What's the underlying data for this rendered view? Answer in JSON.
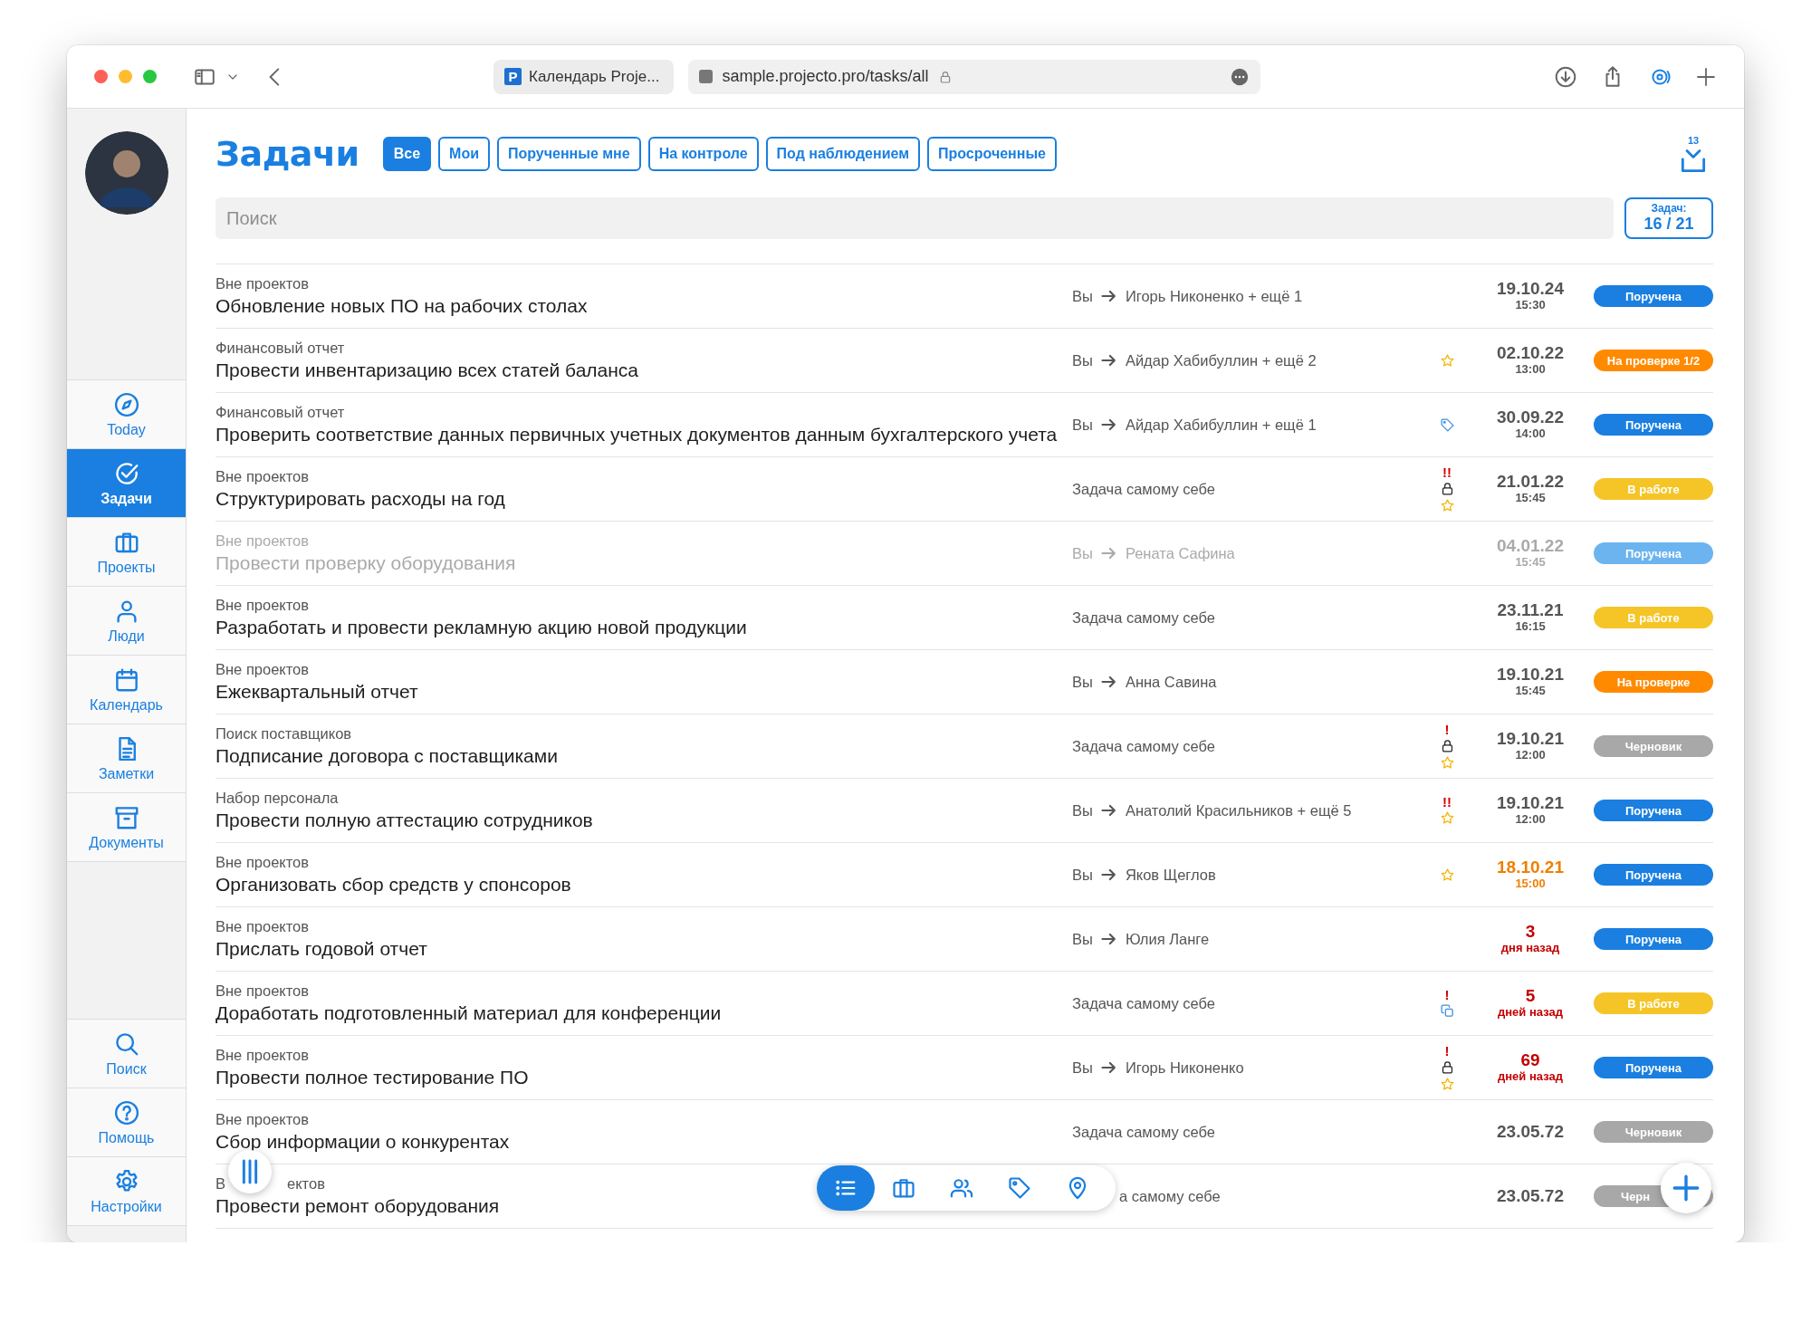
{
  "browser": {
    "favicon_text": "P",
    "tab_title": "Календарь Proje...",
    "url": "sample.projecto.pro/tasks/all"
  },
  "sidebar": {
    "items": [
      {
        "label": "Today",
        "kind": "compass",
        "selected": false
      },
      {
        "label": "Задачи",
        "kind": "check",
        "selected": true
      },
      {
        "label": "Проекты",
        "kind": "briefcase",
        "selected": false
      },
      {
        "label": "Люди",
        "kind": "person",
        "selected": false
      },
      {
        "label": "Календарь",
        "kind": "calendar",
        "selected": false
      },
      {
        "label": "Заметки",
        "kind": "note",
        "selected": false
      },
      {
        "label": "Документы",
        "kind": "archive",
        "selected": false
      }
    ],
    "bottom_items": [
      {
        "label": "Поиск",
        "kind": "search"
      },
      {
        "label": "Помощь",
        "kind": "help"
      },
      {
        "label": "Настройки",
        "kind": "gear"
      }
    ]
  },
  "header": {
    "title": "Задачи",
    "filters": [
      {
        "label": "Все",
        "selected": true
      },
      {
        "label": "Мои",
        "selected": false
      },
      {
        "label": "Порученные мне",
        "selected": false
      },
      {
        "label": "На контроле",
        "selected": false
      },
      {
        "label": "Под наблюдением",
        "selected": false
      },
      {
        "label": "Просроченные",
        "selected": false
      }
    ],
    "inbox_count": "13"
  },
  "search": {
    "placeholder": "Поиск"
  },
  "counter": {
    "label": "Задач:",
    "value": "16 / 21"
  },
  "tasks": [
    {
      "category": "Вне проектов",
      "title": "Обновление новых ПО на рабочих столах",
      "assignee": {
        "kind": "delegated",
        "from": "Вы",
        "to": "Игорь Никоненко + ещё 1"
      },
      "date": "19.10.24",
      "time": "15:30",
      "overdue": false,
      "due_soon": false,
      "status": {
        "label": "Поручена",
        "color": "#1a7fe0"
      },
      "muted": false
    },
    {
      "category": "Финансовый отчет",
      "title": "Провести инвентаризацию всех статей баланса",
      "assignee": {
        "kind": "delegated",
        "from": "Вы",
        "to": "Айдар Хабибуллин + ещё 2"
      },
      "marks": [
        {
          "kind": "star"
        }
      ],
      "date": "02.10.22",
      "time": "13:00",
      "overdue": false,
      "due_soon": false,
      "status": {
        "label": "На проверке 1/2",
        "color": "#ff8a00"
      },
      "muted": false
    },
    {
      "category": "Финансовый отчет",
      "title": "Проверить соответствие данных первичных учетных документов данным бухгалтерского учета",
      "assignee": {
        "kind": "delegated",
        "from": "Вы",
        "to": "Айдар Хабибуллин + ещё 1"
      },
      "marks": [
        {
          "kind": "tag"
        }
      ],
      "date": "30.09.22",
      "time": "14:00",
      "overdue": false,
      "due_soon": false,
      "status": {
        "label": "Поручена",
        "color": "#1a7fe0"
      },
      "muted": false
    },
    {
      "category": "Вне проектов",
      "title": "Структурировать расходы на год",
      "assignee": {
        "kind": "self",
        "text": "Задача самому себе"
      },
      "marks": [
        {
          "kind": "urgency",
          "text": "!!"
        },
        {
          "kind": "lock"
        },
        {
          "kind": "star"
        }
      ],
      "date": "21.01.22",
      "time": "15:45",
      "overdue": false,
      "due_soon": false,
      "status": {
        "label": "В работе",
        "color": "#f5c527"
      },
      "muted": false
    },
    {
      "category": "Вне проектов",
      "title": "Провести проверку оборудования",
      "assignee": {
        "kind": "delegated",
        "from": "Вы",
        "to": "Рената Сафина"
      },
      "date": "04.01.22",
      "time": "15:45",
      "overdue": false,
      "due_soon": false,
      "status": {
        "label": "Поручена",
        "color": "#6cb4ef"
      },
      "muted": true
    },
    {
      "category": "Вне проектов",
      "title": "Разработать и провести рекламную акцию новой продукции",
      "assignee": {
        "kind": "self",
        "text": "Задача самому себе"
      },
      "date": "23.11.21",
      "time": "16:15",
      "overdue": false,
      "due_soon": false,
      "status": {
        "label": "В работе",
        "color": "#f5c527"
      },
      "muted": false
    },
    {
      "category": "Вне проектов",
      "title": "Ежеквартальный отчет",
      "assignee": {
        "kind": "delegated",
        "from": "Вы",
        "to": "Анна Савина"
      },
      "date": "19.10.21",
      "time": "15:45",
      "overdue": false,
      "due_soon": false,
      "status": {
        "label": "На проверке",
        "color": "#ff8a00"
      },
      "muted": false
    },
    {
      "category": "Поиск поставщиков",
      "title": "Подписание договора с поставщиками",
      "assignee": {
        "kind": "self",
        "text": "Задача самому себе"
      },
      "marks": [
        {
          "kind": "urgency",
          "text": "!"
        },
        {
          "kind": "lock"
        },
        {
          "kind": "star"
        }
      ],
      "date": "19.10.21",
      "time": "12:00",
      "overdue": false,
      "due_soon": false,
      "status": {
        "label": "Черновик",
        "color": "#a8a8a8"
      },
      "muted": false
    },
    {
      "category": "Набор персонала",
      "title": "Провести полную аттестацию сотрудников",
      "assignee": {
        "kind": "delegated",
        "from": "Вы",
        "to": "Анатолий Красильников + ещё 5"
      },
      "marks": [
        {
          "kind": "urgency",
          "text": "!!"
        },
        {
          "kind": "star"
        }
      ],
      "date": "19.10.21",
      "time": "12:00",
      "overdue": false,
      "due_soon": false,
      "status": {
        "label": "Поручена",
        "color": "#1a7fe0"
      },
      "muted": false
    },
    {
      "category": "Вне проектов",
      "title": "Организовать сбор средств у спонсоров",
      "assignee": {
        "kind": "delegated",
        "from": "Вы",
        "to": "Яков Щеглов"
      },
      "marks": [
        {
          "kind": "star"
        }
      ],
      "date": "18.10.21",
      "time": "15:00",
      "overdue": false,
      "due_soon": true,
      "status": {
        "label": "Поручена",
        "color": "#1a7fe0"
      },
      "muted": false
    },
    {
      "category": "Вне проектов",
      "title": "Прислать годовой отчет",
      "assignee": {
        "kind": "delegated",
        "from": "Вы",
        "to": "Юлия Ланге"
      },
      "date": "3",
      "time": "дня назад",
      "overdue": true,
      "due_soon": false,
      "status": {
        "label": "Поручена",
        "color": "#1a7fe0"
      },
      "muted": false
    },
    {
      "category": "Вне проектов",
      "title": "Доработать подготовленный материал для конференции",
      "assignee": {
        "kind": "self",
        "text": "Задача самому себе"
      },
      "marks": [
        {
          "kind": "urgency",
          "text": "!"
        },
        {
          "kind": "copy"
        }
      ],
      "date": "5",
      "time": "дней назад",
      "overdue": true,
      "due_soon": false,
      "status": {
        "label": "В работе",
        "color": "#f5c527"
      },
      "muted": false
    },
    {
      "category": "Вне проектов",
      "title": "Провести полное тестирование ПО",
      "assignee": {
        "kind": "delegated",
        "from": "Вы",
        "to": "Игорь Никоненко"
      },
      "marks": [
        {
          "kind": "urgency",
          "text": "!"
        },
        {
          "kind": "lock"
        },
        {
          "kind": "star"
        }
      ],
      "date": "69",
      "time": "дней назад",
      "overdue": true,
      "due_soon": false,
      "status": {
        "label": "Поручена",
        "color": "#1a7fe0"
      },
      "muted": false
    },
    {
      "category": "Вне проектов",
      "title": "Сбор информации о конкурентах",
      "assignee": {
        "kind": "self",
        "text": "Задача самому себе"
      },
      "date": "23.05.72",
      "overdue": false,
      "due_soon": false,
      "status": {
        "label": "Черновик",
        "color": "#a8a8a8"
      },
      "muted": false
    },
    {
      "category_fragments": [
        "В",
        "ектов"
      ],
      "title": "Провести ремонт оборудования",
      "assignee": {
        "kind": "self",
        "text": "а самому себе"
      },
      "date": "23.05.72",
      "overdue": false,
      "due_soon": false,
      "status": {
        "label": "Черн",
        "color": "#a8a8a8"
      },
      "muted": false
    }
  ],
  "bottom_bar": {
    "views": [
      {
        "kind": "list",
        "selected": true
      },
      {
        "kind": "briefcase",
        "selected": false
      },
      {
        "kind": "people",
        "selected": false
      },
      {
        "kind": "tag",
        "selected": false
      },
      {
        "kind": "pin",
        "selected": false
      }
    ]
  }
}
